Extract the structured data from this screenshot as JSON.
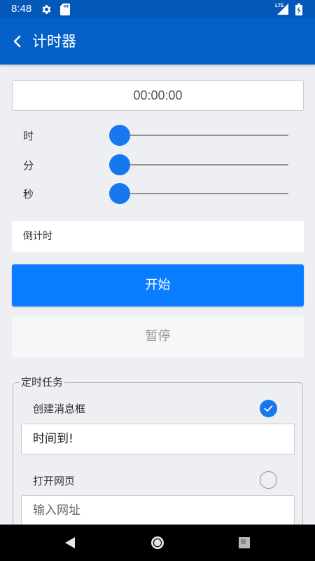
{
  "status_bar": {
    "time": "8:48",
    "network": "LTE",
    "icons": [
      "settings-icon",
      "sd-card-icon",
      "signal-icon",
      "battery-icon"
    ]
  },
  "app_bar": {
    "title": "计时器",
    "back_icon": "chevron-left-icon"
  },
  "timer": {
    "display": "00:00:00"
  },
  "sliders": [
    {
      "label": "时",
      "value": 0
    },
    {
      "label": "分",
      "value": 0
    },
    {
      "label": "秒",
      "value": 0
    }
  ],
  "countdown": {
    "label": "倒计时"
  },
  "buttons": {
    "start": "开始",
    "pause": "暂停"
  },
  "tasks": {
    "legend": "定时任务",
    "items": [
      {
        "label": "创建消息框",
        "checked": true,
        "input_value": "时间到!",
        "input_placeholder": ""
      },
      {
        "label": "打开网页",
        "checked": false,
        "input_value": "",
        "input_placeholder": "输入网址"
      }
    ]
  },
  "colors": {
    "accent": "#0a7cff",
    "app_bar": "#0560c8",
    "status_bar": "#0458b8",
    "background": "#eeeff3"
  },
  "nav_bar": {
    "icons": [
      "back-nav-icon",
      "home-nav-icon",
      "recents-nav-icon"
    ]
  }
}
